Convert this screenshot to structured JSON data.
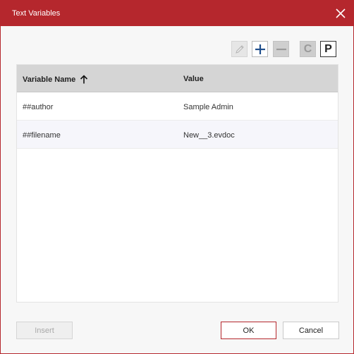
{
  "window": {
    "title": "Text Variables"
  },
  "toolbar": {
    "c_label": "C",
    "p_label": "P"
  },
  "table": {
    "columns": {
      "name": "Variable Name",
      "value": "Value"
    },
    "rows": [
      {
        "name": "##author",
        "value": "Sample Admin"
      },
      {
        "name": "##filename",
        "value": "New__3.evdoc"
      }
    ]
  },
  "footer": {
    "insert_label": "Insert",
    "ok_label": "OK",
    "cancel_label": "Cancel"
  },
  "colors": {
    "accent": "#b5272d",
    "header_bg": "#d5d5d5"
  }
}
